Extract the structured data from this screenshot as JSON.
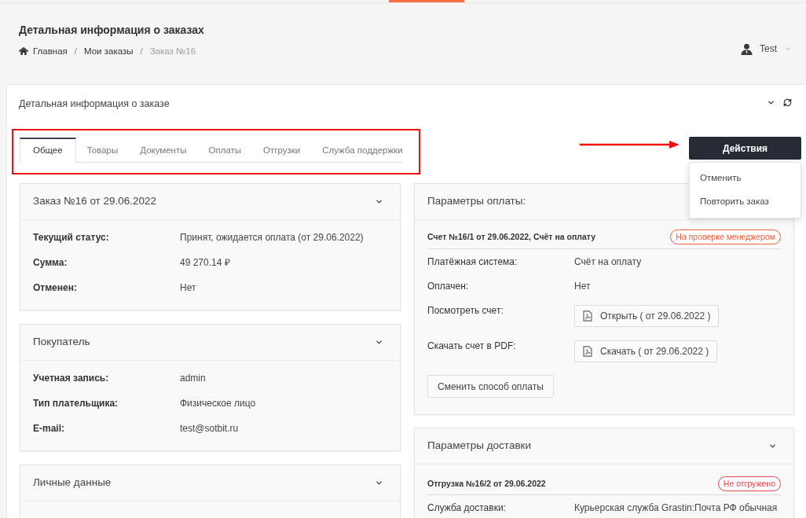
{
  "header": {
    "title": "Детальная информация о заказах",
    "breadcrumbs": [
      {
        "label": "Главная",
        "kind": "home",
        "current": false
      },
      {
        "label": "Мои заказы",
        "kind": "link",
        "separator": "/",
        "current": false
      },
      {
        "label": "Заказ №16",
        "kind": "link",
        "separator": "/",
        "current": true
      }
    ],
    "user": {
      "name": "Test"
    }
  },
  "panel": {
    "title": "Детальная информация о заказе"
  },
  "tabs": [
    {
      "label": "Общее",
      "selected": true
    },
    {
      "label": "Товары",
      "selected": false
    },
    {
      "label": "Документы",
      "selected": false
    },
    {
      "label": "Оплаты",
      "selected": false
    },
    {
      "label": "Отгрузки",
      "selected": false
    },
    {
      "label": "Служба поддержки",
      "selected": false
    }
  ],
  "actions": {
    "label": "Действия",
    "expanded": true,
    "menu": [
      {
        "label": "Отменить"
      },
      {
        "label": "Повторить заказ"
      }
    ]
  },
  "order_cards": [
    {
      "title": "Заказ №16 от 29.06.2022",
      "rows": [
        {
          "label": "Текущий статус:",
          "value": "Принят, ожидается оплата (от 29.06.2022)"
        },
        {
          "label": "Сумма:",
          "value": "49 270.14 ₽"
        },
        {
          "label": "Отменен:",
          "value": "Нет"
        }
      ]
    },
    {
      "title": "Покупатель",
      "rows": [
        {
          "label": "Учетная запись:",
          "value": "admin"
        },
        {
          "label": "Тип плательщика:",
          "value": "Физическое лицо"
        },
        {
          "label": "E-mail:",
          "value": "test@sotbit.ru"
        }
      ]
    },
    {
      "title": "Личные данные"
    }
  ],
  "payment": {
    "title": "Параметры оплаты:",
    "invoice": {
      "title": "Счет №16/1 от 29.06.2022, Счёт на оплату",
      "badge": {
        "label": "На проверке менеджером",
        "color": "#f3603c"
      }
    },
    "rows": [
      {
        "kind": "text",
        "label": "Платёжная система:",
        "value": "Счёт на оплату"
      },
      {
        "kind": "text",
        "label": "Оплачен:",
        "value": "Нет"
      },
      {
        "kind": "button",
        "label": "Посмотреть счет:",
        "value": "Открыть ( от 29.06.2022 )"
      },
      {
        "kind": "button",
        "label": "Скачать счет в PDF:",
        "value": "Скачать ( от 29.06.2022 )"
      }
    ],
    "change_button": "Сменить способ оплаты"
  },
  "delivery": {
    "title": "Параметры доставки",
    "shipment": {
      "title": "Отгрузка №16/2 от 29.06.2022",
      "badge": {
        "label": "Не отгружено",
        "color": "#e9474f"
      }
    },
    "rows": [
      {
        "label": "Служба доставки:",
        "value": "Курьерская служба Grastin:Почта РФ обычная"
      }
    ]
  }
}
